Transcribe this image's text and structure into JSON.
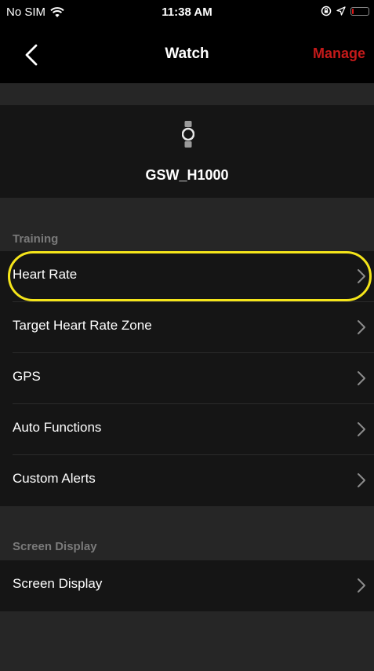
{
  "status_bar": {
    "carrier": "No SIM",
    "time": "11:38 AM",
    "wifi_icon": "wifi-icon",
    "lock_icon": "orientation-lock-icon",
    "location_icon": "location-arrow-icon",
    "battery_icon": "battery-icon",
    "battery_level": 0.1
  },
  "nav": {
    "back_icon": "chevron-left-icon",
    "title": "Watch",
    "manage_label": "Manage"
  },
  "device": {
    "icon": "watch-icon",
    "name": "GSW_H1000"
  },
  "sections": [
    {
      "header": "Training",
      "items": [
        {
          "label": "Heart Rate"
        },
        {
          "label": "Target Heart Rate Zone"
        },
        {
          "label": "GPS"
        },
        {
          "label": "Auto Functions"
        },
        {
          "label": "Custom Alerts"
        }
      ]
    },
    {
      "header": "Screen Display",
      "items": [
        {
          "label": "Screen Display"
        }
      ]
    }
  ],
  "colors": {
    "accent": "#c41a1a",
    "highlight": "#f5e51a",
    "background": "#262626",
    "card": "#151515"
  }
}
